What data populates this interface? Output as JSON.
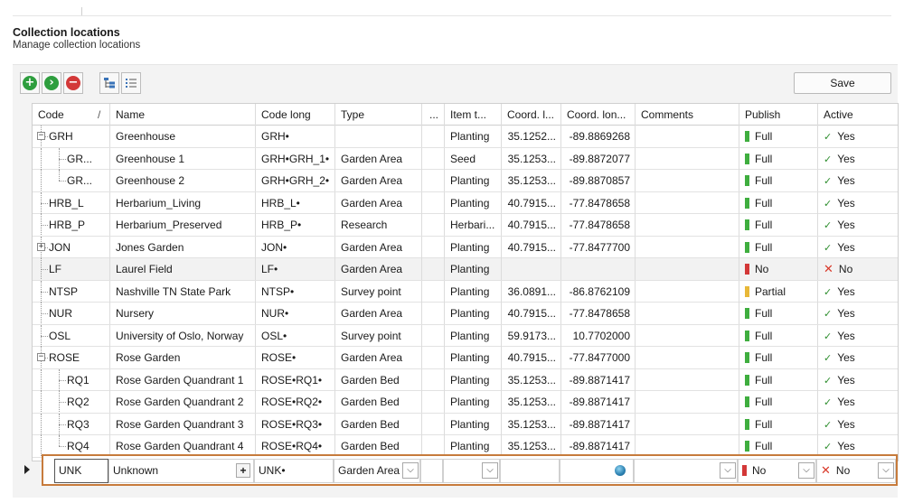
{
  "page": {
    "title": "Collection locations",
    "subtitle": "Manage collection locations"
  },
  "toolbar": {
    "buttons": [
      {
        "name": "add-icon",
        "glyph": "+"
      },
      {
        "name": "go-icon",
        "glyph": "›"
      },
      {
        "name": "delete-icon",
        "glyph": "−"
      },
      {
        "name": "tree-view-icon",
        "glyph": "tree"
      },
      {
        "name": "list-view-icon",
        "glyph": "list"
      }
    ],
    "save_label": "Save"
  },
  "columns": [
    "Code",
    "/",
    "Name",
    "Code long",
    "Type",
    "...",
    "Item t...",
    "Coord. l...",
    "Coord. lon...",
    "Comments",
    "Publish",
    "Active"
  ],
  "rows": [
    {
      "code": "GRH",
      "name": "Greenhouse",
      "code_long": "GRH•",
      "type": "",
      "item": "Planting",
      "lat": "35.1252...",
      "lon": "-89.8869268",
      "comments": "",
      "publish": "Full",
      "publish_color": "#3fae3f",
      "active": "Yes",
      "active_ok": true
    },
    {
      "code": "GR...",
      "name": "Greenhouse 1",
      "code_long": "GRH•GRH_1•",
      "type": "Garden Area",
      "item": "Seed",
      "lat": "35.1253...",
      "lon": "-89.8872077",
      "comments": "",
      "publish": "Full",
      "publish_color": "#3fae3f",
      "active": "Yes",
      "active_ok": true
    },
    {
      "code": "GR...",
      "name": "Greenhouse 2",
      "code_long": "GRH•GRH_2•",
      "type": "Garden Area",
      "item": "Planting",
      "lat": "35.1253...",
      "lon": "-89.8870857",
      "comments": "",
      "publish": "Full",
      "publish_color": "#3fae3f",
      "active": "Yes",
      "active_ok": true
    },
    {
      "code": "HRB_L",
      "name": "Herbarium_Living",
      "code_long": "HRB_L•",
      "type": "Garden Area",
      "item": "Planting",
      "lat": "40.7915...",
      "lon": "-77.8478658",
      "comments": "",
      "publish": "Full",
      "publish_color": "#3fae3f",
      "active": "Yes",
      "active_ok": true
    },
    {
      "code": "HRB_P",
      "name": "Herbarium_Preserved",
      "code_long": "HRB_P•",
      "type": "Research",
      "item": "Herbari...",
      "lat": "40.7915...",
      "lon": "-77.8478658",
      "comments": "",
      "publish": "Full",
      "publish_color": "#3fae3f",
      "active": "Yes",
      "active_ok": true
    },
    {
      "code": "JON",
      "name": "Jones Garden",
      "code_long": "JON•",
      "type": "Garden Area",
      "item": "Planting",
      "lat": "40.7915...",
      "lon": "-77.8477700",
      "comments": "",
      "publish": "Full",
      "publish_color": "#3fae3f",
      "active": "Yes",
      "active_ok": true
    },
    {
      "code": "LF",
      "name": "Laurel Field",
      "code_long": "LF•",
      "type": "Garden Area",
      "item": "Planting",
      "lat": "",
      "lon": "",
      "comments": "",
      "publish": "No",
      "publish_color": "#d33838",
      "active": "No",
      "active_ok": false
    },
    {
      "code": "NTSP",
      "name": "Nashville TN State Park",
      "code_long": "NTSP•",
      "type": "Survey point",
      "item": "Planting",
      "lat": "36.0891...",
      "lon": "-86.8762109",
      "comments": "",
      "publish": "Partial",
      "publish_color": "#e8b838",
      "active": "Yes",
      "active_ok": true
    },
    {
      "code": "NUR",
      "name": "Nursery",
      "code_long": "NUR•",
      "type": "Garden Area",
      "item": "Planting",
      "lat": "40.7915...",
      "lon": "-77.8478658",
      "comments": "",
      "publish": "Full",
      "publish_color": "#3fae3f",
      "active": "Yes",
      "active_ok": true
    },
    {
      "code": "OSL",
      "name": "University of Oslo, Norway",
      "code_long": "OSL•",
      "type": "Survey point",
      "item": "Planting",
      "lat": "59.9173...",
      "lon": "10.7702000",
      "comments": "",
      "publish": "Full",
      "publish_color": "#3fae3f",
      "active": "Yes",
      "active_ok": true
    },
    {
      "code": "ROSE",
      "name": "Rose Garden",
      "code_long": "ROSE•",
      "type": "Garden Area",
      "item": "Planting",
      "lat": "40.7915...",
      "lon": "-77.8477000",
      "comments": "",
      "publish": "Full",
      "publish_color": "#3fae3f",
      "active": "Yes",
      "active_ok": true
    },
    {
      "code": "RQ1",
      "name": "Rose Garden Quandrant 1",
      "code_long": "ROSE•RQ1•",
      "type": "Garden Bed",
      "item": "Planting",
      "lat": "35.1253...",
      "lon": "-89.8871417",
      "comments": "",
      "publish": "Full",
      "publish_color": "#3fae3f",
      "active": "Yes",
      "active_ok": true
    },
    {
      "code": "RQ2",
      "name": "Rose Garden Quandrant 2",
      "code_long": "ROSE•RQ2•",
      "type": "Garden Bed",
      "item": "Planting",
      "lat": "35.1253...",
      "lon": "-89.8871417",
      "comments": "",
      "publish": "Full",
      "publish_color": "#3fae3f",
      "active": "Yes",
      "active_ok": true
    },
    {
      "code": "RQ3",
      "name": "Rose Garden Quandrant 3",
      "code_long": "ROSE•RQ3•",
      "type": "Garden Bed",
      "item": "Planting",
      "lat": "35.1253...",
      "lon": "-89.8871417",
      "comments": "",
      "publish": "Full",
      "publish_color": "#3fae3f",
      "active": "Yes",
      "active_ok": true
    },
    {
      "code": "RQ4",
      "name": "Rose Garden Quandrant 4",
      "code_long": "ROSE•RQ4•",
      "type": "Garden Bed",
      "item": "Planting",
      "lat": "35.1253...",
      "lon": "-89.8871417",
      "comments": "",
      "publish": "Full",
      "publish_color": "#3fae3f",
      "active": "Yes",
      "active_ok": true
    }
  ],
  "new_row": {
    "code": "UNK",
    "name": "Unknown",
    "code_long": "UNK•",
    "type": "Garden Area",
    "publish": "No",
    "publish_color": "#d33838",
    "active": "No"
  },
  "icons": {
    "expand": "+",
    "collapse": "−",
    "check": "✓",
    "cross": "✕",
    "dropdown": "⌵",
    "row_indicator": "▶"
  }
}
